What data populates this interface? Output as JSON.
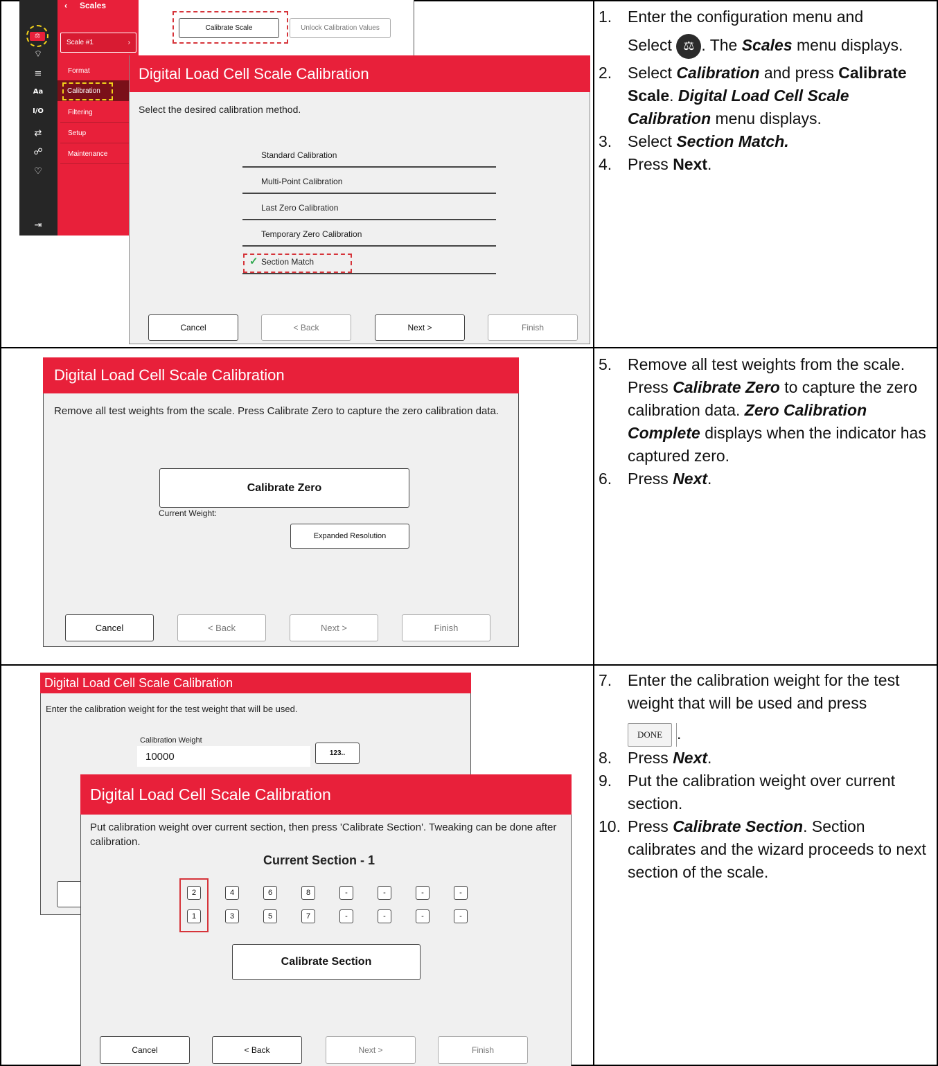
{
  "row1": {
    "scales_header": "Scales",
    "scale_select": "Scale #1",
    "menu": [
      "Format",
      "Calibration",
      "Filtering",
      "Setup",
      "Maintenance"
    ],
    "sidebar_icons": [
      "scale-icon",
      "wifi-icon",
      "list-icon",
      "font-icon",
      "io-icon",
      "network-icon",
      "tree-icon",
      "diagnostics-icon",
      "exit-icon"
    ],
    "calibrate_scale_btn": "Calibrate Scale",
    "unlock_btn": "Unlock Calibration Values",
    "dialog_title": "Digital Load Cell Scale Calibration",
    "prompt": "Select the desired calibration method.",
    "options": [
      "Standard Calibration",
      "Multi-Point Calibration",
      "Last Zero Calibration",
      "Temporary Zero Calibration",
      "Section Match"
    ],
    "selected_option": "Section Match",
    "buttons": {
      "cancel": "Cancel",
      "back": "< Back",
      "next": "Next >",
      "finish": "Finish"
    }
  },
  "row2": {
    "dialog_title": "Digital Load Cell Scale Calibration",
    "prompt": "Remove all test weights from the scale. Press Calibrate Zero to capture the zero calibration data.",
    "calibrate_zero_btn": "Calibrate Zero",
    "current_weight_label": "Current Weight:",
    "expanded_btn": "Expanded Resolution",
    "buttons": {
      "cancel": "Cancel",
      "back": "< Back",
      "next": "Next >",
      "finish": "Finish"
    }
  },
  "row3": {
    "back_dialog": {
      "title": "Digital Load Cell Scale Calibration",
      "prompt": "Enter the calibration weight for the test weight that will be used.",
      "weight_label": "Calibration Weight",
      "weight_value": "10000",
      "keypad_btn": "123.."
    },
    "front_dialog": {
      "title": "Digital Load Cell Scale Calibration",
      "prompt": "Put calibration weight over current section, then press 'Calibrate Section'. Tweaking can be done after calibration.",
      "current_section": "Current Section - 1",
      "sections_top": [
        "2",
        "4",
        "6",
        "8",
        "-",
        "-",
        "-",
        "-"
      ],
      "sections_bottom": [
        "1",
        "3",
        "5",
        "7",
        "-",
        "-",
        "-",
        "-"
      ],
      "calibrate_section_btn": "Calibrate Section",
      "buttons": {
        "cancel": "Cancel",
        "back": "< Back",
        "next": "Next >",
        "finish": "Finish"
      }
    }
  },
  "instructions": {
    "s1": {
      "num": "1.",
      "a": "Enter the configuration menu and",
      "b": "Select",
      "c": ". The",
      "d": "Scales",
      "e": "menu displays."
    },
    "s2": {
      "num": "2.",
      "a": "Select",
      "b": "Calibration",
      "c": "and press",
      "d": "Calibrate Scale",
      "e": ".",
      "f": "Digital Load Cell Scale Calibration",
      "g": "menu displays."
    },
    "s3": {
      "num": "3.",
      "a": "Select",
      "b": "Section Match."
    },
    "s4": {
      "num": "4.",
      "a": "Press",
      "b": "Next",
      "c": "."
    },
    "s5": {
      "num": "5.",
      "a": "Remove all test weights from the scale. Press",
      "b": "Calibrate Zero",
      "c": "to capture the zero calibration data.",
      "d": "Zero Calibration Complete",
      "e": "displays when the indicator has captured zero."
    },
    "s6": {
      "num": "6.",
      "a": "Press",
      "b": "Next",
      "c": "."
    },
    "s7": {
      "num": "7.",
      "a": "Enter the calibration weight for the test weight that will be used and press",
      "done": "DONE",
      "c": "."
    },
    "s8": {
      "num": "8.",
      "a": "Press",
      "b": "Next",
      "c": "."
    },
    "s9": {
      "num": "9.",
      "a": "Put the calibration weight over current section."
    },
    "s10": {
      "num": "10.",
      "a": "Press",
      "b": "Calibrate Section",
      "c": ". Section calibrates and the wizard proceeds to next section of the scale."
    }
  },
  "colors": {
    "brand_red": "#e8203a",
    "dark_sidebar": "#262626",
    "highlight_red_dash": "#d6343a",
    "highlight_yellow_dash": "#f2d21a",
    "check_green": "#2fa84f"
  }
}
